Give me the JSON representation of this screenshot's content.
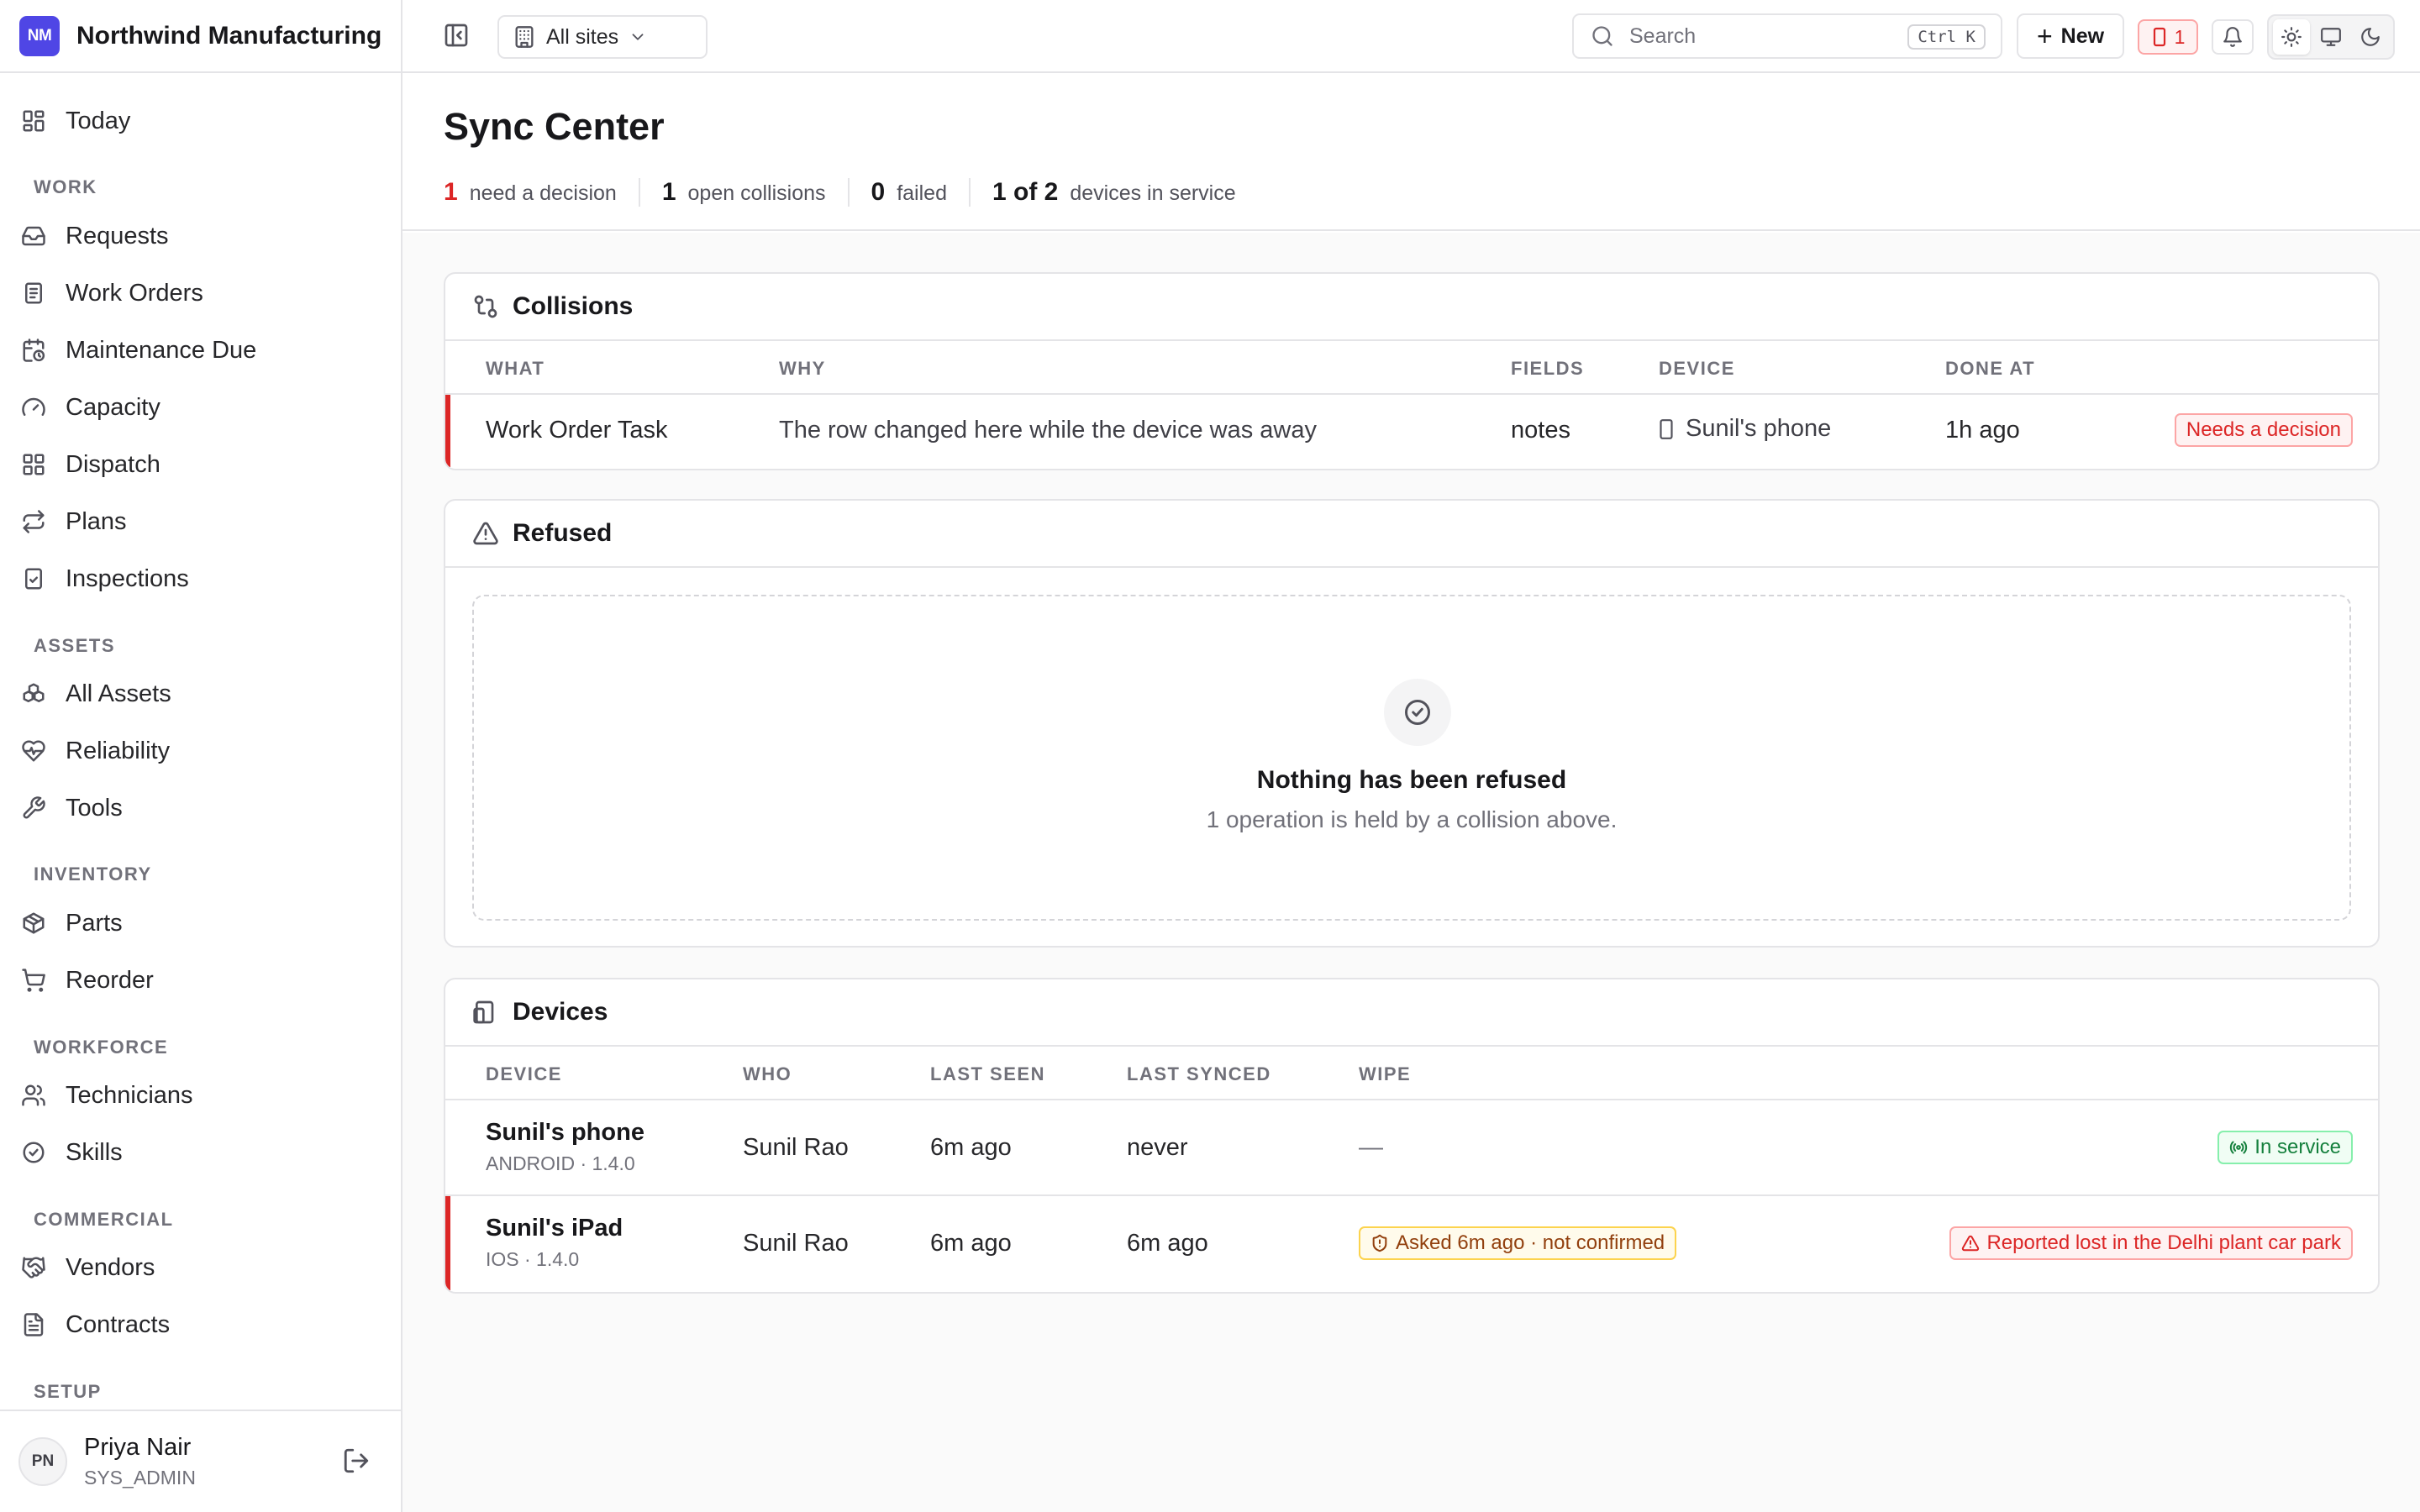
{
  "brand": {
    "initials": "NM",
    "name": "Northwind Manufacturing"
  },
  "nav": {
    "today": "Today",
    "sections": {
      "work": "WORK",
      "assets": "ASSETS",
      "inventory": "INVENTORY",
      "workforce": "WORKFORCE",
      "commercial": "COMMERCIAL",
      "setup": "SETUP"
    },
    "items": {
      "requests": "Requests",
      "work_orders": "Work Orders",
      "maintenance_due": "Maintenance Due",
      "capacity": "Capacity",
      "dispatch": "Dispatch",
      "plans": "Plans",
      "inspections": "Inspections",
      "all_assets": "All Assets",
      "reliability": "Reliability",
      "tools": "Tools",
      "parts": "Parts",
      "reorder": "Reorder",
      "technicians": "Technicians",
      "skills": "Skills",
      "vendors": "Vendors",
      "contracts": "Contracts"
    }
  },
  "user": {
    "initials": "PN",
    "name": "Priya Nair",
    "role": "SYS_ADMIN"
  },
  "topbar": {
    "site_select": "All sites",
    "search_placeholder": "Search",
    "search_shortcut": "Ctrl K",
    "new_label": "New",
    "device_alert_count": "1"
  },
  "page": {
    "title": "Sync Center",
    "stats": [
      {
        "value": "1",
        "label": "need a decision"
      },
      {
        "value": "1",
        "label": "open collisions"
      },
      {
        "value": "0",
        "label": "failed"
      },
      {
        "value": "1 of 2",
        "label": "devices in service"
      }
    ]
  },
  "collisions": {
    "title": "Collisions",
    "columns": [
      "WHAT",
      "WHY",
      "FIELDS",
      "DEVICE",
      "DONE AT"
    ],
    "rows": [
      {
        "what": "Work Order Task",
        "why": "The row changed here while the device was away",
        "fields": "notes",
        "device": "Sunil's phone",
        "done_at": "1h ago",
        "status": "Needs a decision"
      }
    ]
  },
  "refused": {
    "title": "Refused",
    "empty_title": "Nothing has been refused",
    "empty_sub": "1 operation is held by a collision above."
  },
  "devices": {
    "title": "Devices",
    "columns": [
      "DEVICE",
      "WHO",
      "LAST SEEN",
      "LAST SYNCED",
      "WIPE"
    ],
    "rows": [
      {
        "name": "Sunil's phone",
        "platform": "ANDROID · 1.4.0",
        "who": "Sunil Rao",
        "last_seen": "6m ago",
        "last_synced": "never",
        "wipe": "—",
        "status": "In service"
      },
      {
        "name": "Sunil's iPad",
        "platform": "IOS · 1.4.0",
        "who": "Sunil Rao",
        "last_seen": "6m ago",
        "last_synced": "6m ago",
        "wipe": "Asked 6m ago · not confirmed",
        "status": "Reported lost in the Delhi plant car park"
      }
    ]
  },
  "colors": {
    "accent": "#4f46e5",
    "danger": "#dc2626",
    "success": "#15803d",
    "warning": "#92400e",
    "border": "#e4e4e7"
  }
}
